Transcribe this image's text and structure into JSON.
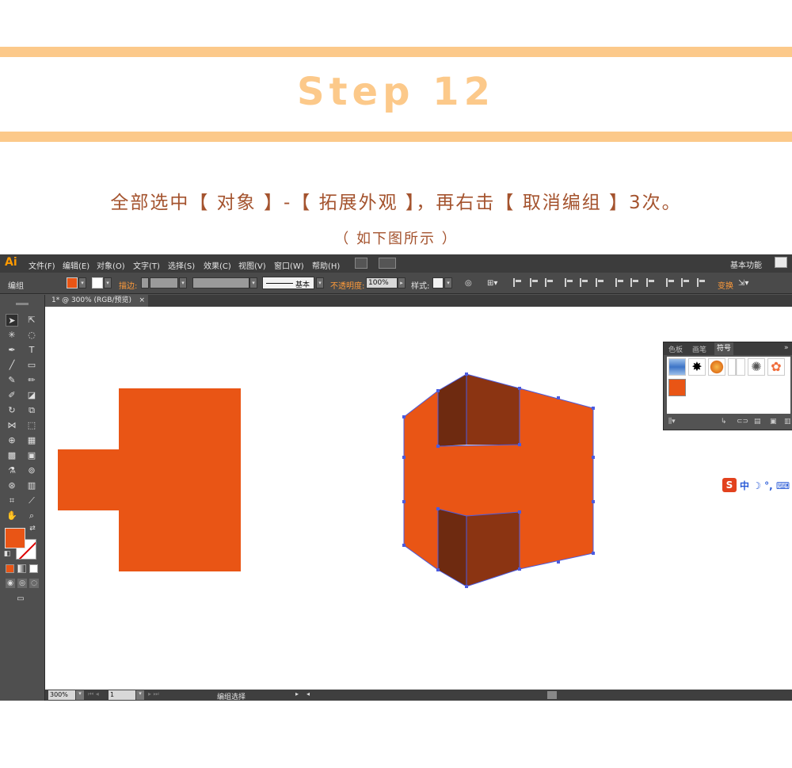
{
  "header": {
    "step_title": "Step 12",
    "instruction": "全部选中【 对象 】-【 拓展外观 】，再右击【 取消编组 】3次。",
    "sub_instruction": "（ 如下图所示 ）"
  },
  "app": {
    "logo": "Ai",
    "menu": [
      "文件(F)",
      "编辑(E)",
      "对象(O)",
      "文字(T)",
      "选择(S)",
      "效果(C)",
      "视图(V)",
      "窗口(W)",
      "帮助(H)"
    ],
    "workspace": "基本功能",
    "control_bar": {
      "selection_label": "编组",
      "stroke_label": "描边:",
      "stroke_style": "基本",
      "opacity_label": "不透明度:",
      "opacity_value": "100%",
      "style_label": "样式:",
      "transform_label": "变换"
    },
    "document_tab": {
      "title": "1* @ 300% (RGB/预览)",
      "close": "×"
    },
    "status_bar": {
      "zoom": "300%",
      "page": "1",
      "status": "编组选择"
    },
    "symbols_panel": {
      "tabs": [
        "色板",
        "画笔",
        "符号"
      ],
      "active_tab": "符号"
    },
    "ime": {
      "logo": "S",
      "text": "中 ☽ °, ⌨"
    }
  },
  "colors": {
    "accent": "#fcc98a",
    "text_brown": "#a4532e",
    "shape_orange": "#e95515",
    "shape_dark": "#8b3412",
    "shape_darker": "#6e2a10",
    "selection_blue": "#4a5be0"
  }
}
